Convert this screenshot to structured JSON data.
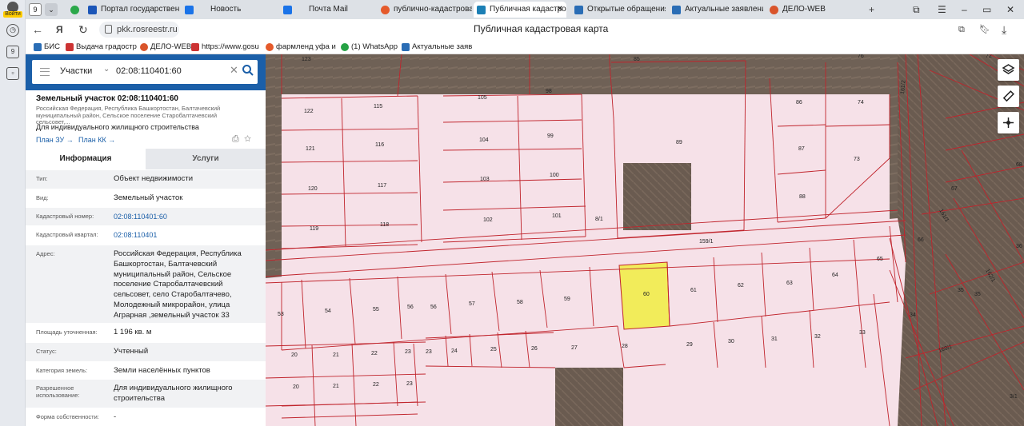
{
  "browser": {
    "tab_count": "9",
    "login_label": "Войти",
    "tabs": [
      {
        "label": "Портал государственн",
        "color": "#1c56b8"
      },
      {
        "label": "Новость",
        "color": "#1a73e8"
      },
      {
        "label": "Почта Mail",
        "color": "#1a73e8"
      },
      {
        "label": "публично-кадастрова",
        "color": "#e55a2b"
      },
      {
        "label": "Публичная кадастро",
        "color": "#1b7fb5"
      },
      {
        "label": "Открытые обращения",
        "color": "#2a6db5"
      },
      {
        "label": "Актуальные заявления",
        "color": "#2a6db5"
      },
      {
        "label": "ДЕЛО-WEB",
        "color": "#d9542b"
      }
    ],
    "url": "pkk.rosreestr.ru",
    "page_title": "Публичная кадастровая карта",
    "bookmarks": [
      "БИС",
      "Выдача градостр",
      "ДЕЛО-WEB",
      "https://www.gosu",
      "фармленд уфа и",
      "(1) WhatsApp",
      "Актуальные заяв"
    ],
    "sidebar_badge": "9"
  },
  "search": {
    "category": "Участки",
    "value": "02:08:110401:60"
  },
  "object": {
    "title": "Земельный участок 02:08:110401:60",
    "address_short": "Российская Федерация, Республика Башкортостан, Балтачевский муниципальный район, Сельское поселение Старобалтачевский сельсовет,...",
    "use": "Для индивидуального жилищного строительства",
    "plan_zu": "План ЗУ →",
    "plan_kk": "План КК →"
  },
  "info_tabs": {
    "info": "Информация",
    "services": "Услуги"
  },
  "fields": [
    {
      "k": "Тип:",
      "v": "Объект недвижимости"
    },
    {
      "k": "Вид:",
      "v": "Земельный участок"
    },
    {
      "k": "Кадастровый номер:",
      "v": "02:08:110401:60"
    },
    {
      "k": "Кадастровый квартал:",
      "v": "02:08:110401"
    },
    {
      "k": "Адрес:",
      "v": "Российская Федерация, Республика Башкортостан, Балтачевский муниципальный район, Сельское поселение Старобалтачевский сельсовет, село Старобалтачево, Молодежный микрорайон, улица Аграрная ,земельный участок 33"
    },
    {
      "k": "Площадь уточненная:",
      "v": "1 196 кв. м"
    },
    {
      "k": "Статус:",
      "v": "Учтенный"
    },
    {
      "k": "Категория земель:",
      "v": "Земли населённых пунктов"
    },
    {
      "k": "Разрешенное использование:",
      "v": "Для индивидуального жилищного строительства"
    },
    {
      "k": "Форма собственности:",
      "v": "-"
    }
  ],
  "map": {
    "parcel_fill": "#f6e1e8",
    "boundary_color": "#c0242c",
    "selected_fill": "#f2ec5a",
    "labels": [
      "123",
      "85",
      "76",
      "72",
      "105",
      "98",
      "122",
      "115",
      "86",
      "74",
      "121",
      "116",
      "104",
      "99",
      "89",
      "87",
      "73",
      "120",
      "117",
      "103",
      "100",
      "88",
      "67",
      "119",
      "118",
      "102",
      "101",
      "8/1",
      "159/1",
      "66",
      "53",
      "54",
      "55",
      "56",
      "56",
      "57",
      "58",
      "59",
      "60",
      "61",
      "62",
      "63",
      "64",
      "65",
      "35",
      "35",
      "34",
      "20",
      "21",
      "22",
      "23",
      "23",
      "24",
      "25",
      "26",
      "27",
      "28",
      "29",
      "30",
      "31",
      "32",
      "33",
      "20",
      "21",
      "22",
      "23",
      "160/1",
      "36",
      "68",
      "3/1",
      "161/1",
      "162/1",
      "161/2"
    ]
  }
}
